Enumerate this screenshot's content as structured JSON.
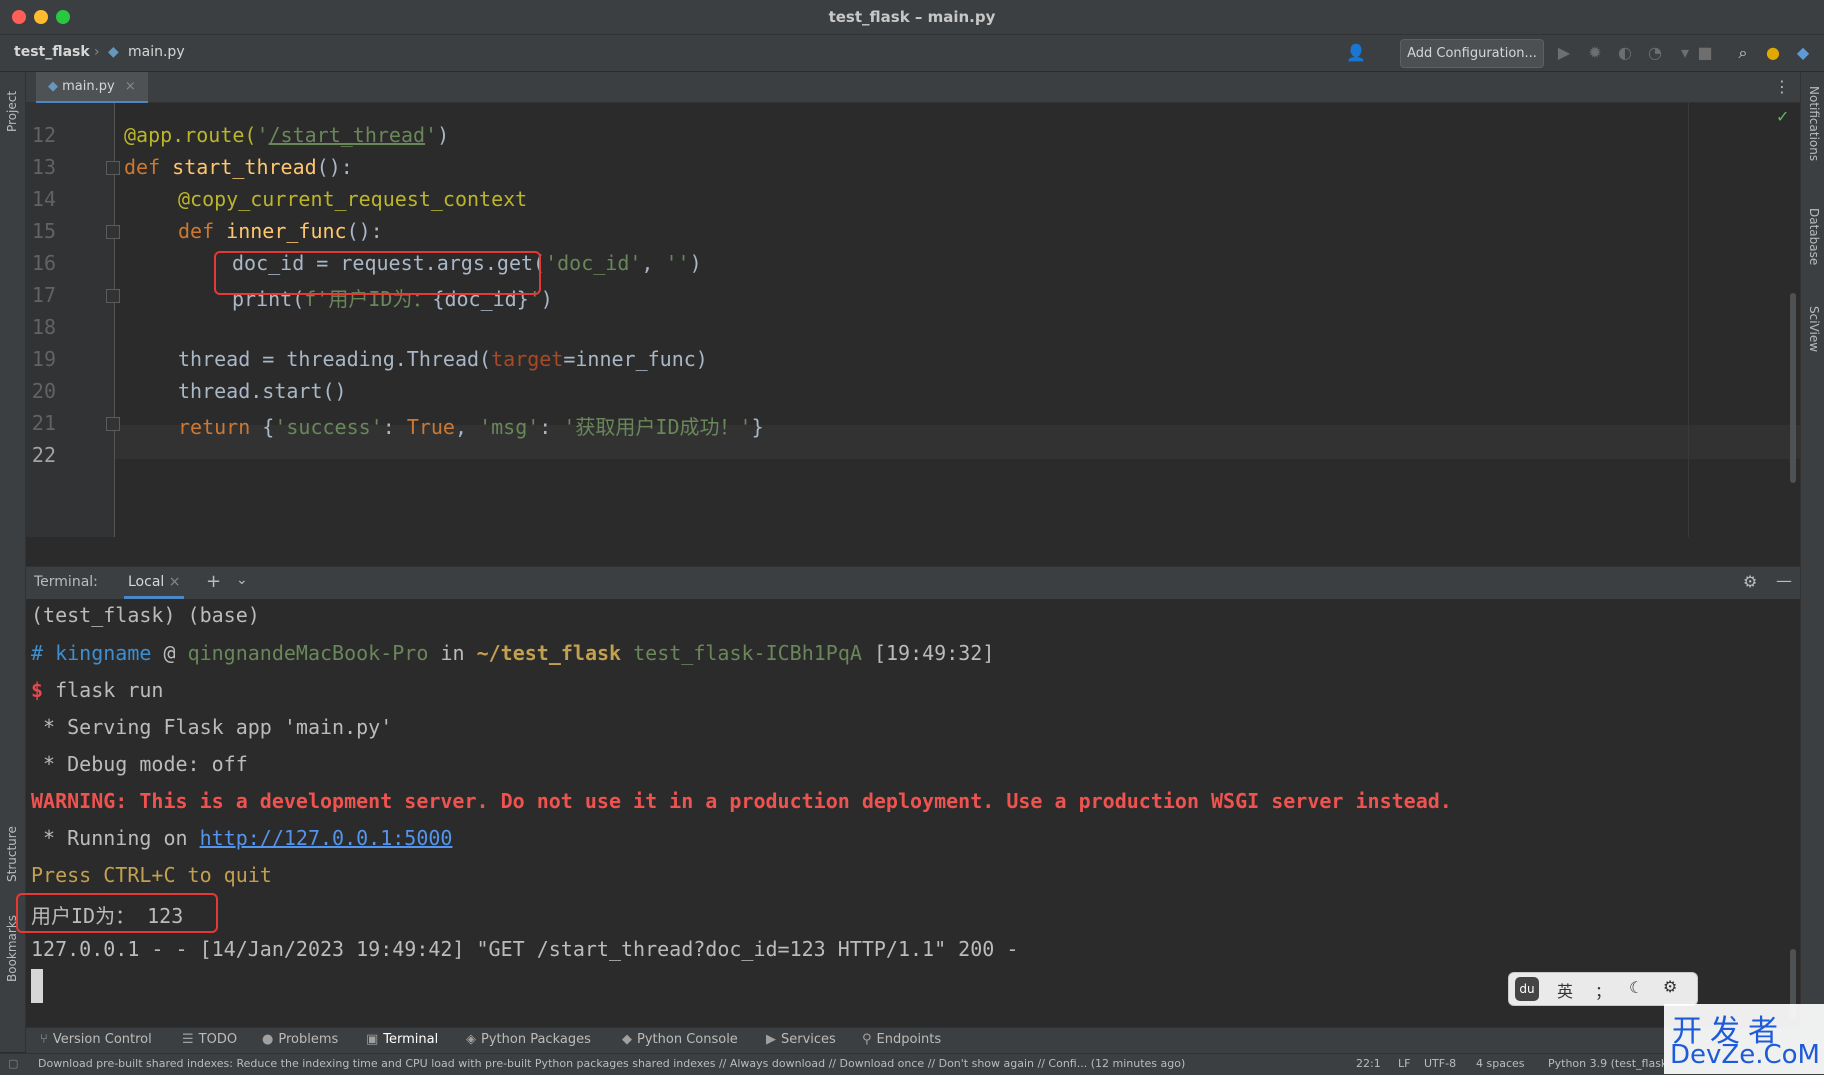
{
  "window": {
    "title": "test_flask – main.py"
  },
  "navbar": {
    "project": "test_flask",
    "file": "main.py",
    "add_configuration": "Add Configuration..."
  },
  "editor_tab": {
    "label": "main.py"
  },
  "left_tools": {
    "project": "Project",
    "structure": "Structure",
    "bookmarks": "Bookmarks"
  },
  "right_tools": {
    "notifications": "Notifications",
    "database": "Database",
    "sciview": "SciView"
  },
  "code": {
    "line_numbers": [
      "12",
      "13",
      "14",
      "15",
      "16",
      "17",
      "18",
      "19",
      "20",
      "21",
      "22"
    ],
    "l12": {
      "dec": "@app.route(",
      "q1": "'",
      "path": "/start_thread",
      "q2": "'",
      "close": ")"
    },
    "l13": {
      "kw": "def ",
      "fn": "start_thread",
      "rest": "():"
    },
    "l14": {
      "dec": "@copy_current_request_context"
    },
    "l15": {
      "kw": "def ",
      "fn": "inner_func",
      "rest": "():"
    },
    "l16": {
      "a": "doc_id = request.args.get(",
      "s1": "'doc_id'",
      "b": ", ",
      "s2": "''",
      "c": ")"
    },
    "l17": {
      "a": "print(",
      "s": "f'用户ID为：",
      "b": "{doc_id}",
      "s2": "'",
      "c": ")"
    },
    "l19": {
      "a": "thread = threading.Thread(",
      "p": "target",
      "b": "=inner_func)"
    },
    "l20": {
      "a": "thread.start()"
    },
    "l21": {
      "kw": "return ",
      "a": "{",
      "s1": "'success'",
      "b": ": ",
      "kw2": "True",
      "c": ", ",
      "s2": "'msg'",
      "d": ": ",
      "s3": "'获取用户ID成功！'",
      "e": "}"
    }
  },
  "terminal": {
    "label": "Terminal:",
    "tab": "Local",
    "lines": {
      "env": "(test_flask) (base)",
      "hash": "#",
      "user": "kingname",
      "at": "@",
      "host": "qingnandeMacBook-Pro",
      "in": "in",
      "dir": "~/test_flask",
      "branch": "test_flask-ICBh1PqA",
      "time": "[19:49:32]",
      "dollar": "$",
      "cmd": "flask run",
      "serving": " * Serving Flask app 'main.py'",
      "debug": " * Debug mode: off",
      "warning": "WARNING: This is a development server. Do not use it in a production deployment. Use a production WSGI server instead.",
      "running": " * Running on ",
      "url": "http://127.0.0.1:5000",
      "quit": "Press CTRL+C to quit",
      "userid": "用户ID为： 123",
      "request": "127.0.0.1 - - [14/Jan/2023 19:49:42] \"GET /start_thread?doc_id=123 HTTP/1.1\" 200 -"
    }
  },
  "ime": {
    "lang": "英",
    "punct": "；",
    "moon": "☾",
    "gear": "⚙"
  },
  "tool_windows": [
    "Version Control",
    "TODO",
    "Problems",
    "Terminal",
    "Python Packages",
    "Python Console",
    "Services",
    "Endpoints"
  ],
  "status": {
    "message": "Download pre-built shared indexes: Reduce the indexing time and CPU load with pre-built Python packages shared indexes // Always download // Download once // Don't show again // Confi... (12 minutes ago)",
    "position": "22:1",
    "line_sep": "LF",
    "encoding": "UTF-8",
    "indent": "4 spaces",
    "interpreter": "Python 3.9 (test_flask-ICBh1PqA)"
  },
  "watermark": {
    "line1": "开发者",
    "line2": "DevZe.CoM"
  },
  "colors": {
    "highlight_box": "#e53935",
    "accent": "#4a88c7"
  }
}
